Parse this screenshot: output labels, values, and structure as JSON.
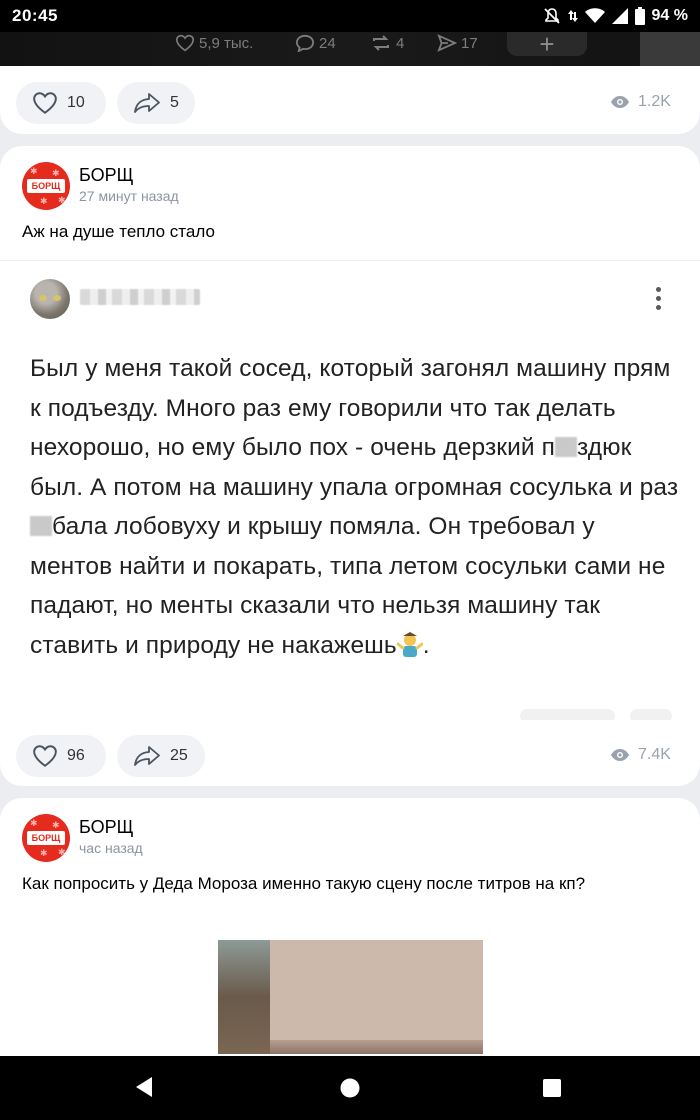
{
  "status_bar": {
    "time": "20:45",
    "battery_percent": "94 %",
    "icons": [
      "mute-icon",
      "data-arrows-icon",
      "wifi-icon",
      "signal-icon",
      "battery-icon"
    ]
  },
  "repost_strip": {
    "likes": "5,9 тыс.",
    "comments": "24",
    "reposts": "4",
    "shares": "17",
    "plus_label": "+"
  },
  "post_prev": {
    "likes": "10",
    "shares": "5",
    "views": "1.2K"
  },
  "post_1": {
    "author": "БОРЩ",
    "time_ago": "27 минут назад",
    "avatar_label": "БОРЩ",
    "text": "Аж на душе тепло стало",
    "screenshot": {
      "paragraph": [
        "Был у меня такой сосед, который загонял машину прям к подъезду. Много раз ему говорили что так делать нехорошо, но ему было пох - очень дерзкий п",
        "здюк был. А потом на машину упала огромная сосулька и раз",
        "бала лобовуху и крышу помяла. Он требовал у ментов найти и покарать, типа летом сосульки сами не падают, но менты сказали что нельзя машину так ставить и природу не накажешь",
        "."
      ]
    },
    "likes": "96",
    "shares": "25",
    "views": "7.4K"
  },
  "post_2": {
    "author": "БОРЩ",
    "time_ago": "час назад",
    "avatar_label": "БОРЩ",
    "text": "Как попросить у Деда Мороза именно такую сцену после титров на кп?"
  },
  "colors": {
    "brand_red": "#e52a1e",
    "page_bg": "#ebedf0",
    "pill_bg": "#f0f2f5",
    "muted": "#8b95a1"
  }
}
